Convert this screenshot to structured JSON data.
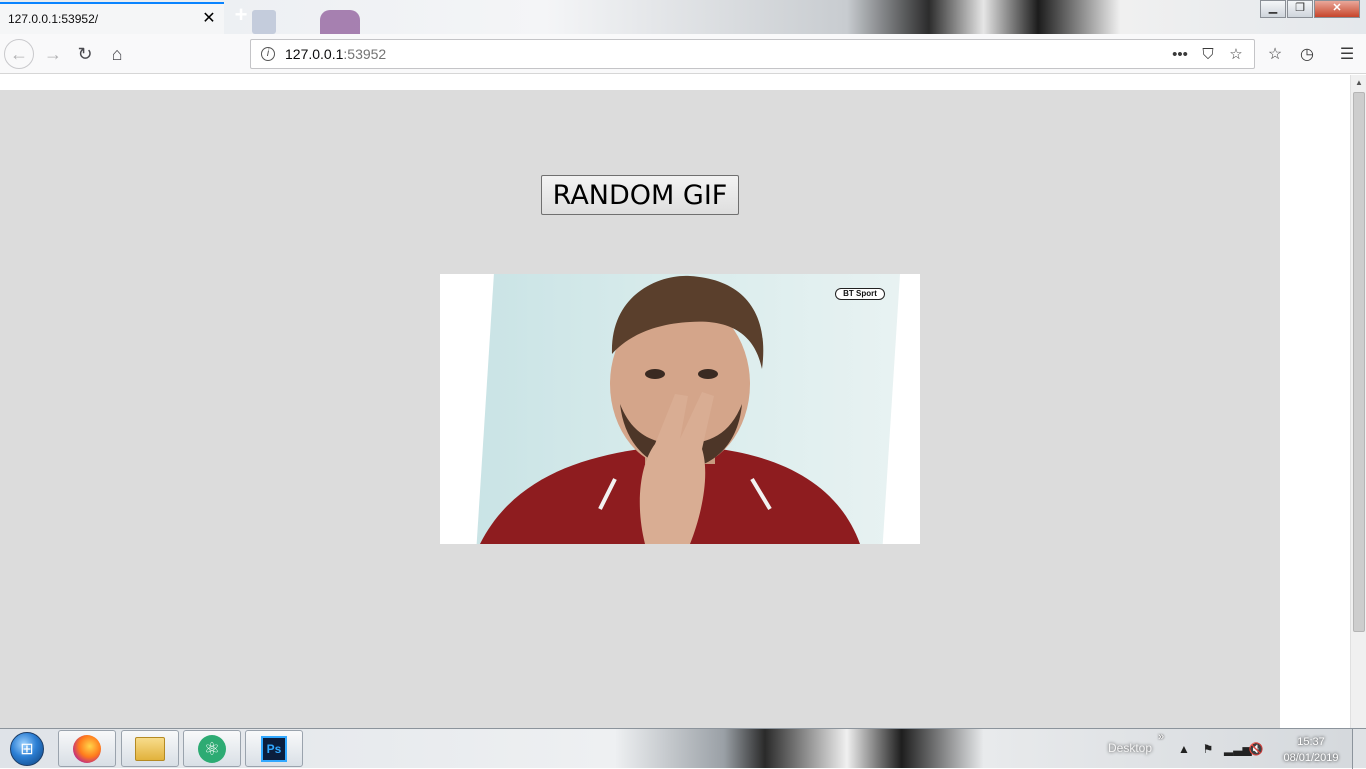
{
  "browser": {
    "tab_title": "127.0.0.1:53952/",
    "url_host": "127.0.0.1",
    "url_port": ":53952"
  },
  "page": {
    "button_label": "RANDOM GIF",
    "gif_watermark": "BT Sport"
  },
  "taskbar": {
    "apps": [
      "firefox-icon",
      "file-explorer-icon",
      "atom-icon",
      "photoshop-icon"
    ],
    "photoshop_label": "Ps",
    "desktop_label": "Desktop",
    "time": "15:37",
    "date": "08/01/2019"
  },
  "colors": {
    "page_background": "#dcdcdc",
    "tab_accent": "#0a84ff"
  }
}
